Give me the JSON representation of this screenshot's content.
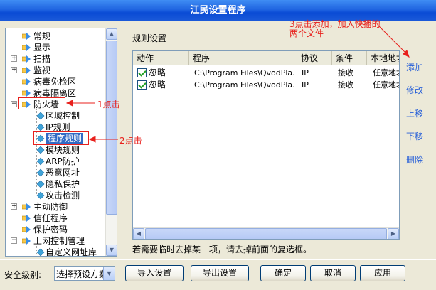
{
  "window": {
    "title": "江民设置程序"
  },
  "tree": {
    "items": [
      {
        "label": "常规",
        "level": 0,
        "expander": ""
      },
      {
        "label": "显示",
        "level": 0,
        "expander": ""
      },
      {
        "label": "扫描",
        "level": 0,
        "expander": "+"
      },
      {
        "label": "监视",
        "level": 0,
        "expander": "+"
      },
      {
        "label": "病毒免检区",
        "level": 0,
        "expander": ""
      },
      {
        "label": "病毒隔离区",
        "level": 0,
        "expander": ""
      },
      {
        "label": "防火墙",
        "level": 0,
        "expander": "-"
      },
      {
        "label": "区域控制",
        "level": 1,
        "expander": ""
      },
      {
        "label": "IP规则",
        "level": 1,
        "expander": ""
      },
      {
        "label": "程序规则",
        "level": 1,
        "expander": "",
        "selected": true
      },
      {
        "label": "模块规则",
        "level": 1,
        "expander": ""
      },
      {
        "label": "ARP防护",
        "level": 1,
        "expander": ""
      },
      {
        "label": "恶意网址",
        "level": 1,
        "expander": ""
      },
      {
        "label": "隐私保护",
        "level": 1,
        "expander": ""
      },
      {
        "label": "攻击检测",
        "level": 1,
        "expander": ""
      },
      {
        "label": "主动防御",
        "level": 0,
        "expander": "+"
      },
      {
        "label": "信任程序",
        "level": 0,
        "expander": ""
      },
      {
        "label": "保护密码",
        "level": 0,
        "expander": ""
      },
      {
        "label": "上网控制管理",
        "level": 0,
        "expander": "-"
      },
      {
        "label": "自定义网址库",
        "level": 1,
        "expander": ""
      }
    ]
  },
  "rules": {
    "section_title": "规则设置",
    "columns": [
      "动作",
      "程序",
      "协议",
      "条件",
      "本地地址"
    ],
    "rows": [
      {
        "action": "忽略",
        "program": "C:\\Program Files\\QvodPla...",
        "protocol": "IP",
        "condition": "接收",
        "local": "任意地址",
        "checked": true
      },
      {
        "action": "忽略",
        "program": "C:\\Program Files\\QvodPla...",
        "protocol": "IP",
        "condition": "接收",
        "local": "任意地址",
        "checked": true
      }
    ]
  },
  "side_actions": {
    "add": "添加",
    "edit": "修改",
    "up": "上移",
    "down": "下移",
    "delete": "删除"
  },
  "hint": "若需要临时去掉某一项，请去掉前面的复选框。",
  "footer": {
    "security_label": "安全级别:",
    "preset_value": "选择预设方案",
    "import": "导入设置",
    "export": "导出设置",
    "ok": "确定",
    "cancel": "取消",
    "apply": "应用"
  },
  "annotations": {
    "step1": "1点击",
    "step2": "2点击",
    "step3_line1": "3点击添加，加入快播的",
    "step3_line2": "两个文件"
  },
  "colors": {
    "title_bar": "#1F64E0",
    "link": "#2860D8",
    "annotation": "#E8201C",
    "selection": "#316AC5"
  }
}
